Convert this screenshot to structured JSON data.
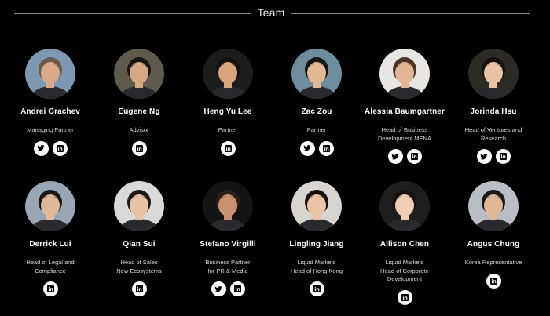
{
  "section": {
    "title": "Team"
  },
  "members": [
    {
      "name": "Andrei Grachev",
      "role": "Managing Partner",
      "socials": [
        "twitter",
        "linkedin"
      ],
      "avatar_bg": "#7d98b3",
      "skin": "#d9a98a",
      "hair": "#6a5a4a"
    },
    {
      "name": "Eugene Ng",
      "role": "Advisor",
      "socials": [
        "linkedin"
      ],
      "avatar_bg": "#5f5a4e",
      "skin": "#d5a884",
      "hair": "#1a1613"
    },
    {
      "name": "Heng Yu Lee",
      "role": "Partner",
      "socials": [
        "linkedin"
      ],
      "avatar_bg": "#1c1c1c",
      "skin": "#d9a37c",
      "hair": "#141210"
    },
    {
      "name": "Zac Zou",
      "role": "Partner",
      "socials": [
        "twitter",
        "linkedin"
      ],
      "avatar_bg": "#6e8ea0",
      "skin": "#e0b894",
      "hair": "#151413"
    },
    {
      "name": "Alessia Baumgartner",
      "role": "Head of Business\nDevelopment MENA",
      "socials": [
        "twitter",
        "linkedin"
      ],
      "avatar_bg": "#e8e6e3",
      "skin": "#e3b594",
      "hair": "#4a3428"
    },
    {
      "name": "Jorinda Hsu",
      "role": "Head of Ventures and\nResearch",
      "socials": [
        "twitter",
        "linkedin"
      ],
      "avatar_bg": "#2b2a25",
      "skin": "#eac3a4",
      "hair": "#14110f"
    },
    {
      "name": "Derrick Lui",
      "role": "Head of Legal and\nCompliance",
      "socials": [
        "linkedin"
      ],
      "avatar_bg": "#9aa6b4",
      "skin": "#e0b899",
      "hair": "#1a1816"
    },
    {
      "name": "Qian Sui",
      "role": "Head of Sales\nNew Ecosystems",
      "socials": [
        "linkedin"
      ],
      "avatar_bg": "#d9d9d9",
      "skin": "#e9c3a4",
      "hair": "#1c1a19"
    },
    {
      "name": "Stefano Virgilli",
      "role": "Business Partner\nfor PR & Media",
      "socials": [
        "twitter",
        "linkedin"
      ],
      "avatar_bg": "#141414",
      "skin": "#c99170",
      "hair": "#2c1f16"
    },
    {
      "name": "Lingling Jiang",
      "role": "Liquid Markets\nHead of Hong Kong",
      "socials": [
        "linkedin"
      ],
      "avatar_bg": "#d8d4cf",
      "skin": "#eac4a5",
      "hair": "#17110e"
    },
    {
      "name": "Allison Chen",
      "role": "Liquid Markets\nHead of Corporate\nDevelopment",
      "socials": [
        "linkedin"
      ],
      "avatar_bg": "#1e1e1e",
      "skin": "#efcdb3",
      "hair": "#16110e"
    },
    {
      "name": "Angus Chung",
      "role": "Korea Representative",
      "socials": [
        "linkedin"
      ],
      "avatar_bg": "#b9bec4",
      "skin": "#e0b898",
      "hair": "#1a1817"
    }
  ]
}
